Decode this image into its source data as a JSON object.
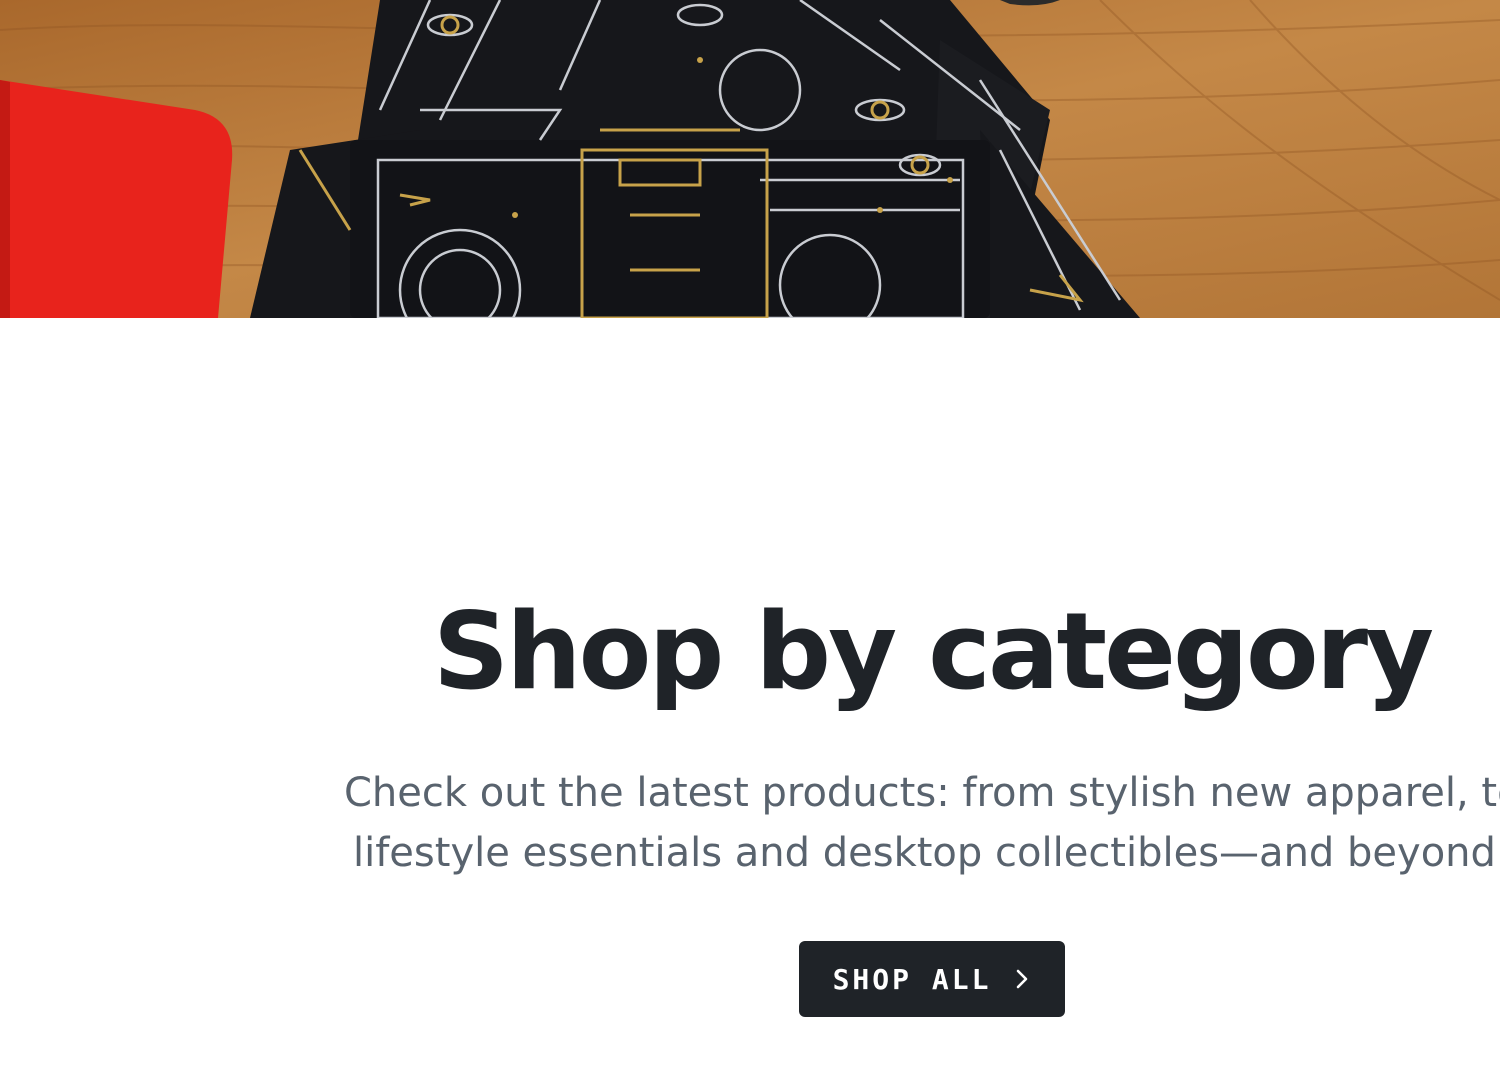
{
  "hero": {
    "image_name": "playing-cards-hero-image",
    "colors": {
      "wood": "#b87a3c",
      "felt": "#e8231c",
      "card": "#16171b",
      "line_silver": "#c9ccd2",
      "line_gold": "#c7a24a"
    }
  },
  "section": {
    "heading": "Shop by category",
    "description_line1": "Check out the latest products: from stylish new apparel, to",
    "description_line2": "lifestyle essentials and desktop collectibles—and beyond."
  },
  "cta": {
    "label": "SHOP ALL",
    "icon": "chevron-right-icon",
    "background": "#1f2328",
    "text_color": "#ffffff"
  },
  "colors": {
    "heading": "#1f2328",
    "body_text": "#59636e",
    "background": "#ffffff"
  }
}
